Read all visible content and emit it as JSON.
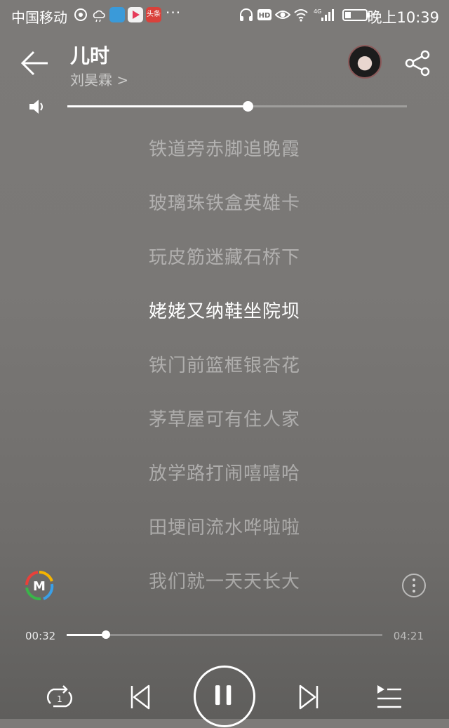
{
  "status_bar": {
    "carrier": "中国移动",
    "time": "晚上10:39",
    "badge_label": "头条",
    "icons": [
      "nfc-icon",
      "weather-icon",
      "app-icon-blue",
      "youku-icon",
      "toutiao-icon",
      "more-dots-icon",
      "headphone-icon",
      "hd-icon",
      "eye-icon",
      "wifi-icon",
      "4g-signal-icon",
      "battery-icon"
    ],
    "dots": "···"
  },
  "header": {
    "title": "儿时",
    "artist": "刘昊霖 >"
  },
  "volume": {
    "level": 0.53
  },
  "lyrics": {
    "lines": [
      "铁道旁赤脚追晚霞",
      "玻璃珠铁盒英雄卡",
      "玩皮筋迷藏石桥下",
      "姥姥又纳鞋坐院坝",
      "铁门前篮框银杏花",
      "茅草屋可有住人家",
      "放学路打闹嘻嘻哈",
      "田埂间流水哗啦啦",
      "我们就一天天长大"
    ],
    "current_index": 3
  },
  "progress": {
    "current": "00:32",
    "total": "04:21",
    "fraction": 0.125
  },
  "controls": {
    "repeat_count": "1"
  },
  "colors": {
    "accent": "#ffffff"
  }
}
